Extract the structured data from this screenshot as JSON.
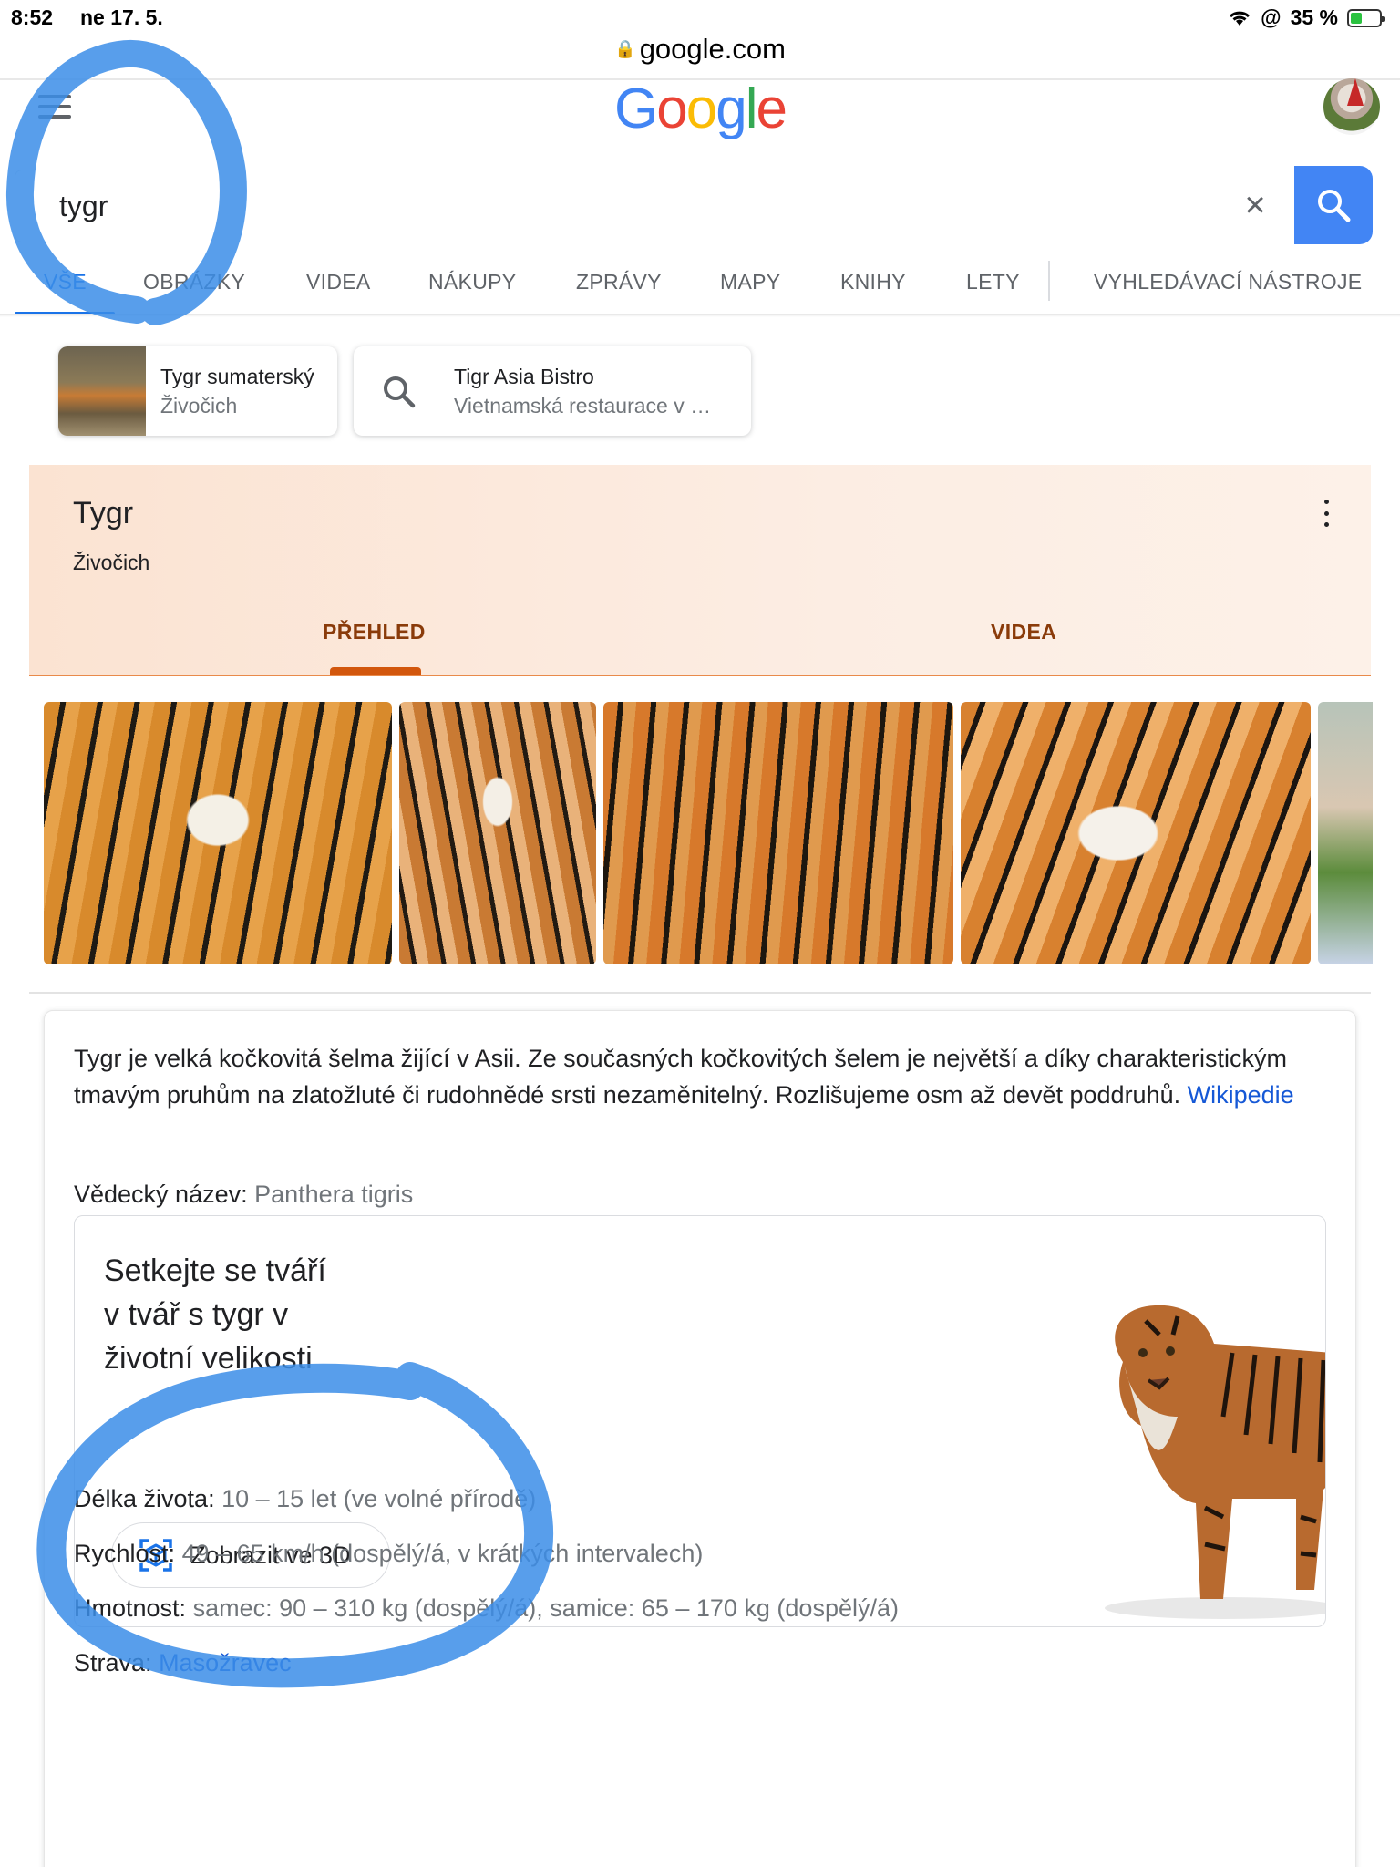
{
  "status_bar": {
    "time": "8:52",
    "date": "ne 17. 5.",
    "location_icon": "@",
    "battery": "35 %"
  },
  "url_bar": {
    "domain": "google.com",
    "lock_icon": "lock-icon"
  },
  "search": {
    "query": "tygr",
    "clear_label": "×"
  },
  "tabs": [
    {
      "label": "VŠE",
      "active": true
    },
    {
      "label": "OBRÁZKY"
    },
    {
      "label": "VIDEA"
    },
    {
      "label": "NÁKUPY"
    },
    {
      "label": "ZPRÁVY"
    },
    {
      "label": "MAPY"
    },
    {
      "label": "KNIHY"
    },
    {
      "label": "LETY"
    },
    {
      "label": "VYHLEDÁVACÍ NÁSTROJE"
    }
  ],
  "chips": [
    {
      "title": "Tygr sumaterský",
      "subtitle": "Živočich"
    },
    {
      "title": "Tigr Asia Bistro",
      "subtitle": "Vietnamská restaurace v …"
    }
  ],
  "knowledge_panel": {
    "title": "Tygr",
    "subtitle": "Živočich",
    "tabs": [
      "PŘEHLED",
      "VIDEA"
    ]
  },
  "description": {
    "text": "Tygr je velká kočkovitá šelma žijící v Asii. Ze současných kočkovitých šelem je největší a díky charakteristickým tmavým pruhům na zlatožluté či rudohnědé srsti nezaměnitelný. Rozlišujeme osm až devět poddruhů.",
    "source_link": "Wikipedie"
  },
  "facts": {
    "scientific_name": {
      "label": "Vědecký název:",
      "value": "Panthera tigris"
    },
    "lifespan": {
      "label": "Délka života:",
      "value": "10 – 15 let (ve volné přírodě)"
    },
    "speed": {
      "label": "Rychlost:",
      "value": "49 – 65 km/h (dospělý/á, v krátkých intervalech)"
    },
    "mass": {
      "label": "Hmotnost:",
      "value": "samec: 90 – 310 kg (dospělý/á), samice: 65 – 170 kg (dospělý/á)"
    },
    "diet": {
      "label": "Strava:",
      "value": "Masožravec"
    }
  },
  "view_3d": {
    "title_lines": [
      "Setkejte se tváří",
      "v tvář s tygr v",
      "životní velikosti"
    ],
    "button_label": "Zobrazit ve 3D"
  },
  "colors": {
    "accent_blue": "#1a73e8",
    "search_button": "#4285f4",
    "kp_tab_active": "#8a3b0a",
    "kp_underline": "#d2570d",
    "annotation": "#3b8de8"
  }
}
